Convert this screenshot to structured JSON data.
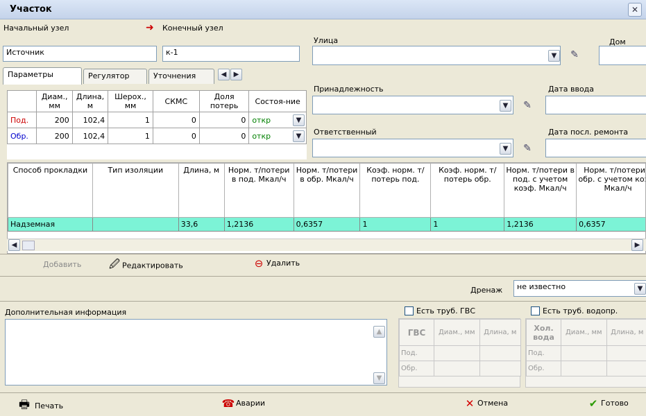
{
  "window": {
    "title": "Участок",
    "close_glyph": "✕"
  },
  "nodes": {
    "start_label": "Начальный узел",
    "start_value": "Источник",
    "end_label": "Конечный узел",
    "end_value": "к-1"
  },
  "address": {
    "street_label": "Улица",
    "street_value": "",
    "house_label": "Дом",
    "house_value": "",
    "ownership_label": "Принадлежность",
    "ownership_value": "",
    "commission_date_label": "Дата ввода",
    "commission_date_value": "",
    "responsible_label": "Ответственный",
    "responsible_value": "",
    "last_repair_label": "Дата посл. ремонта",
    "last_repair_value": ""
  },
  "tabs": [
    {
      "label": "Параметры",
      "active": true
    },
    {
      "label": "Регулятор",
      "active": false
    },
    {
      "label": "Уточнения",
      "active": false
    }
  ],
  "params_table": {
    "headers": [
      "Диам., мм",
      "Длина, м",
      "Шерох., мм",
      "СКМС",
      "Доля потерь",
      "Состоя-ние"
    ],
    "rows": [
      {
        "label": "Под.",
        "diam": "200",
        "length": "102,4",
        "rough": "1",
        "skms": "0",
        "loss": "0",
        "state": "откр"
      },
      {
        "label": "Обр.",
        "diam": "200",
        "length": "102,4",
        "rough": "1",
        "skms": "0",
        "loss": "0",
        "state": "откр"
      }
    ]
  },
  "grid": {
    "headers": [
      "Способ прокладки",
      "Тип изоляции",
      "Длина, м",
      "Норм. т/потери в под. Мкал/ч",
      "Норм. т/потери в обр. Мкал/ч",
      "Коэф. норм. т/потерь под.",
      "Коэф. норм. т/потерь обр.",
      "Норм. т/потери в под. с учетом коэф. Мкал/ч",
      "Норм. т/потери в обр. с учетом коэф. Мкал/ч"
    ],
    "rows": [
      [
        "Надземная",
        "",
        "33,6",
        "1,2136",
        "0,6357",
        "1",
        "1",
        "1,2136",
        "0,6357"
      ]
    ]
  },
  "actions": {
    "add": "Добавить",
    "edit": "Редактировать",
    "delete": "Удалить"
  },
  "drain": {
    "label": "Дренаж",
    "value": "не известно"
  },
  "extra_info": {
    "label": "Дополнительная информация",
    "value": ""
  },
  "gvs": {
    "checkbox_label": "Есть труб. ГВС",
    "header": "ГВС",
    "col_diam": "Диам., мм",
    "col_length": "Длина, м",
    "row_supply": "Под.",
    "row_return": "Обр."
  },
  "cold_water": {
    "checkbox_label": "Есть труб. водопр.",
    "header": "Хол. вода",
    "col_diam": "Диам., мм",
    "col_length": "Длина, м",
    "row_supply": "Под.",
    "row_return": "Обр."
  },
  "footer": {
    "print": "Печать",
    "accidents": "Аварии",
    "cancel": "Отмена",
    "done": "Готово"
  },
  "colors": {
    "grid_row": "#7cf3d6",
    "state_text": "#008000",
    "row_label": "#cc0000",
    "row_label_return": "#0000cc",
    "arrow": "#cc0000"
  }
}
